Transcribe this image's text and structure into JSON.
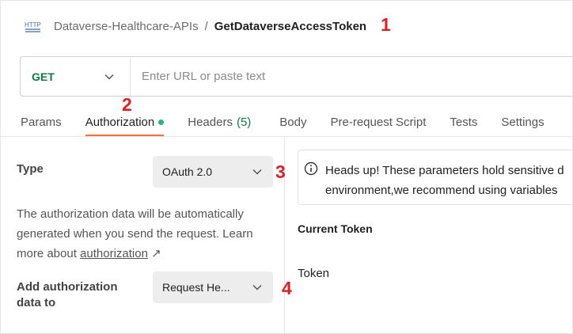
{
  "breadcrumb": {
    "icon_text": "HTTP",
    "collection": "Dataverse-Healthcare-APIs",
    "separator": "/",
    "request": "GetDataverseAccessToken"
  },
  "markers": [
    "1",
    "2",
    "3",
    "4"
  ],
  "url_bar": {
    "method": "GET",
    "placeholder": "Enter URL or paste text",
    "value": ""
  },
  "tabs": [
    {
      "label": "Params"
    },
    {
      "label": "Authorization",
      "active": true,
      "dot": true
    },
    {
      "label": "Headers",
      "count": "(5)"
    },
    {
      "label": "Body"
    },
    {
      "label": "Pre-request Script"
    },
    {
      "label": "Tests"
    },
    {
      "label": "Settings"
    }
  ],
  "auth": {
    "type_label": "Type",
    "type_value": "OAuth 2.0",
    "description_text": "The authorization data will be automatically generated when you send the request. Learn more about ",
    "description_link": "authorization",
    "description_arrow": "↗",
    "add_to_label": "Add authorization data to",
    "add_to_value": "Request He..."
  },
  "notice": {
    "line1": "Heads up! These parameters hold sensitive d",
    "line2": "environment,we recommend using variables"
  },
  "token": {
    "heading": "Current Token",
    "label": "Token"
  },
  "colors": {
    "accent": "#ff6c37",
    "method": "#0c7a43",
    "dot": "#26b47f",
    "marker": "#e02020"
  },
  "icons": [
    "http-icon",
    "chevron-down-icon",
    "info-icon",
    "external-link-icon"
  ]
}
